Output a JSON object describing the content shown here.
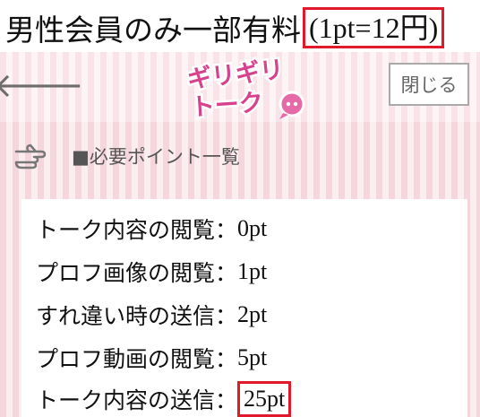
{
  "caption": {
    "text": "男性会員のみ一部有料",
    "price": "(1pt=12円)"
  },
  "header": {
    "back_icon": "arrow-left-icon",
    "logo": {
      "line1": "ギリギリ",
      "line2": "トーク"
    },
    "close_label": "閉じる"
  },
  "section": {
    "icon": "pointing-hand-icon",
    "title": "■必要ポイント一覧"
  },
  "points": [
    {
      "label": "トーク内容の閲覧：",
      "value": "0pt"
    },
    {
      "label": "プロフ画像の閲覧：",
      "value": "1pt"
    },
    {
      "label": "すれ違い時の送信：",
      "value": "2pt"
    },
    {
      "label": "プロフ動画の閲覧：",
      "value": "5pt"
    },
    {
      "label": "トーク内容の送信：",
      "value": "25pt"
    }
  ],
  "colors": {
    "highlight": "#e1192a",
    "logo_pink": "#d8418c",
    "stripe": "#f4d6dd"
  }
}
